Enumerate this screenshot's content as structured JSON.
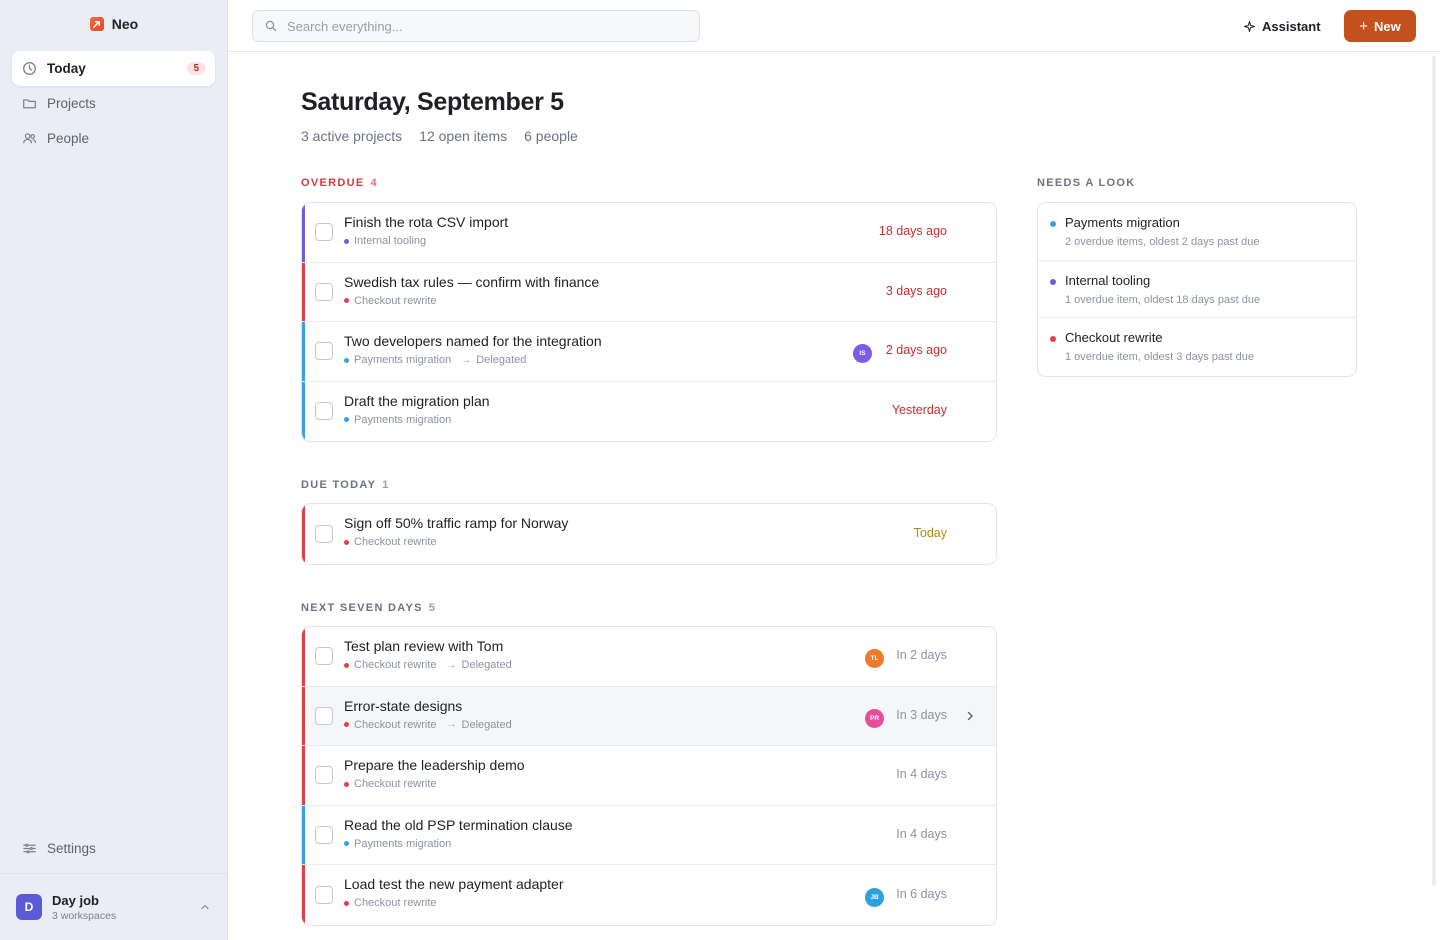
{
  "app": {
    "name": "Neo"
  },
  "sidebar": {
    "items": [
      {
        "label": "Today",
        "badge": "5",
        "icon": "clock-icon"
      },
      {
        "label": "Projects",
        "icon": "folder-icon"
      },
      {
        "label": "People",
        "icon": "people-icon"
      }
    ],
    "settings_label": "Settings",
    "workspace": {
      "avatar": "D",
      "name": "Day job",
      "sub": "3 workspaces"
    }
  },
  "topbar": {
    "search_placeholder": "Search everything...",
    "assistant_label": "Assistant",
    "new_label": "New"
  },
  "main": {
    "title": "Saturday, September 5",
    "stats": [
      "3 active projects",
      "12 open items",
      "6 people"
    ]
  },
  "colors": {
    "payments": "#3aa0e0",
    "internal": "#6b5fd6",
    "checkout": "#e0404a",
    "accent": "#c4501c"
  },
  "sections": {
    "overdue": {
      "name": "OVERDUE",
      "count": "4",
      "rows": [
        {
          "title": "Finish the rota CSV import",
          "project": "Internal tooling",
          "color": "#6b5fd6",
          "due": "18 days ago",
          "due_style": "red"
        },
        {
          "title": "Swedish tax rules — confirm with finance",
          "project": "Checkout rewrite",
          "color": "#e0404a",
          "due": "3 days ago",
          "due_style": "red"
        },
        {
          "title": "Two developers named for the integration",
          "project": "Payments migration",
          "color": "#3aa0e0",
          "delegated": "Delegated",
          "avatar": "IS",
          "avatar_color": "#7b5ce6",
          "due": "2 days ago",
          "due_style": "red"
        },
        {
          "title": "Draft the migration plan",
          "project": "Payments migration",
          "color": "#3aa0e0",
          "due": "Yesterday",
          "due_style": "red"
        }
      ]
    },
    "due_today": {
      "name": "DUE TODAY",
      "count": "1",
      "rows": [
        {
          "title": "Sign off 50% traffic ramp for Norway",
          "project": "Checkout rewrite",
          "color": "#e0404a",
          "due": "Today",
          "due_style": "amber"
        }
      ]
    },
    "next_seven": {
      "name": "NEXT SEVEN DAYS",
      "count": "5",
      "rows": [
        {
          "title": "Test plan review with Tom",
          "project": "Checkout rewrite",
          "color": "#e0404a",
          "delegated": "Delegated",
          "avatar": "TL",
          "avatar_color": "#ef7a2a",
          "due": "In 2 days",
          "due_style": "gray"
        },
        {
          "title": "Error-state designs",
          "project": "Checkout rewrite",
          "color": "#e0404a",
          "delegated": "Delegated",
          "avatar": "PR",
          "avatar_color": "#e64e9a",
          "due": "In 3 days",
          "due_style": "gray",
          "hover": true
        },
        {
          "title": "Prepare the leadership demo",
          "project": "Checkout rewrite",
          "color": "#e0404a",
          "due": "In 4 days",
          "due_style": "gray"
        },
        {
          "title": "Read the old PSP termination clause",
          "project": "Payments migration",
          "color": "#3aa0e0",
          "due": "In 4 days",
          "due_style": "gray"
        },
        {
          "title": "Load test the new payment adapter",
          "project": "Checkout rewrite",
          "color": "#e0404a",
          "avatar": "JB",
          "avatar_color": "#2f9fe0",
          "due": "In 6 days",
          "due_style": "gray"
        }
      ]
    }
  },
  "needs_look": {
    "label": "NEEDS A LOOK",
    "items": [
      {
        "title": "Payments migration",
        "sub": "2 overdue items, oldest 2 days past due",
        "color": "#3aa0e0"
      },
      {
        "title": "Internal tooling",
        "sub": "1 overdue item, oldest 18 days past due",
        "color": "#6b5fd6"
      },
      {
        "title": "Checkout rewrite",
        "sub": "1 overdue item, oldest 3 days past due",
        "color": "#e0404a"
      }
    ]
  }
}
